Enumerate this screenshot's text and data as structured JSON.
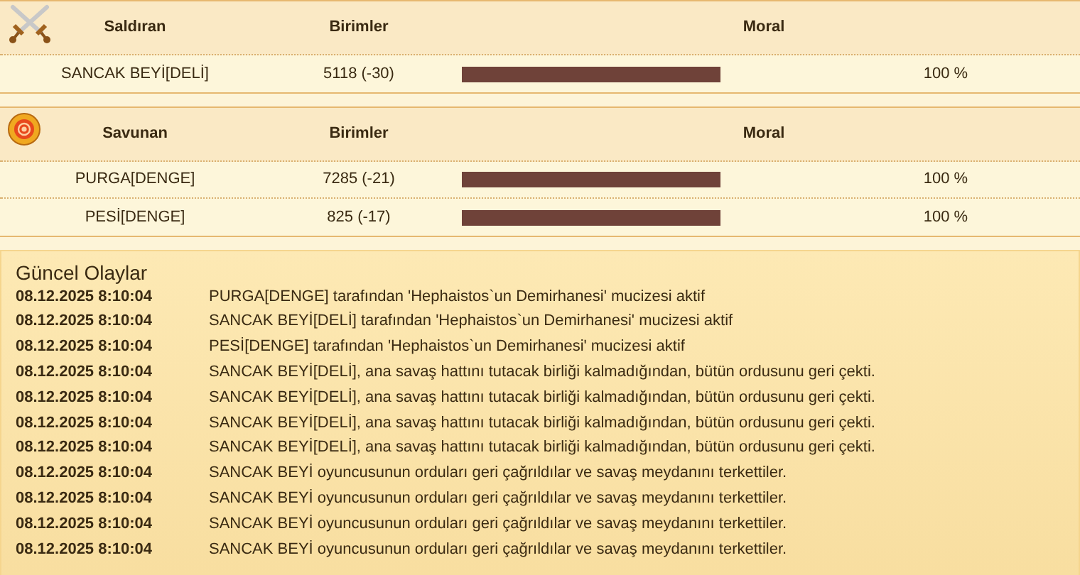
{
  "tables": [
    {
      "kind": "attacker",
      "headers": [
        "Saldıran",
        "Birimler",
        "Moral"
      ],
      "rows": [
        {
          "name": "SANCAK BEYİ[DELİ]",
          "units": "5118 (-30)",
          "percent": "100 %"
        }
      ]
    },
    {
      "kind": "defender",
      "headers": [
        "Savunan",
        "Birimler",
        "Moral"
      ],
      "rows": [
        {
          "name": "PURGA[DENGE]",
          "units": "7285 (-21)",
          "percent": "100 %"
        },
        {
          "name": "PESİ[DENGE]",
          "units": "825 (-17)",
          "percent": "100 %"
        }
      ]
    }
  ],
  "events": {
    "title": "Güncel Olaylar",
    "rows": [
      {
        "time": "08.12.2025 8:10:04",
        "text": "PURGA[DENGE] tarafından 'Hephaistos`un Demirhanesi' mucizesi aktif"
      },
      {
        "time": "08.12.2025 8:10:04",
        "text": "SANCAK BEYİ[DELİ] tarafından 'Hephaistos`un Demirhanesi' mucizesi aktif"
      },
      {
        "time": "08.12.2025 8:10:04",
        "text": "PESİ[DENGE] tarafından 'Hephaistos`un Demirhanesi' mucizesi aktif"
      },
      {
        "time": "08.12.2025 8:10:04",
        "text": "SANCAK BEYİ[DELİ], ana savaş hattını tutacak birliği kalmadığından, bütün ordusunu geri çekti."
      },
      {
        "time": "08.12.2025 8:10:04",
        "text": "SANCAK BEYİ[DELİ], ana savaş hattını tutacak birliği kalmadığından, bütün ordusunu geri çekti."
      },
      {
        "time": "08.12.2025 8:10:04",
        "text": "SANCAK BEYİ[DELİ], ana savaş hattını tutacak birliği kalmadığından, bütün ordusunu geri çekti."
      },
      {
        "time": "08.12.2025 8:10:04",
        "text": "SANCAK BEYİ[DELİ], ana savaş hattını tutacak birliği kalmadığından, bütün ordusunu geri çekti."
      },
      {
        "time": "08.12.2025 8:10:04",
        "text": "SANCAK BEYİ oyuncusunun orduları geri çağrıldılar ve savaş meydanını terkettiler."
      },
      {
        "time": "08.12.2025 8:10:04",
        "text": "SANCAK BEYİ oyuncusunun orduları geri çağrıldılar ve savaş meydanını terkettiler."
      },
      {
        "time": "08.12.2025 8:10:04",
        "text": "SANCAK BEYİ oyuncusunun orduları geri çağrıldılar ve savaş meydanını terkettiler."
      },
      {
        "time": "08.12.2025 8:10:04",
        "text": "SANCAK BEYİ oyuncusunun orduları geri çağrıldılar ve savaş meydanını terkettiler."
      }
    ]
  }
}
